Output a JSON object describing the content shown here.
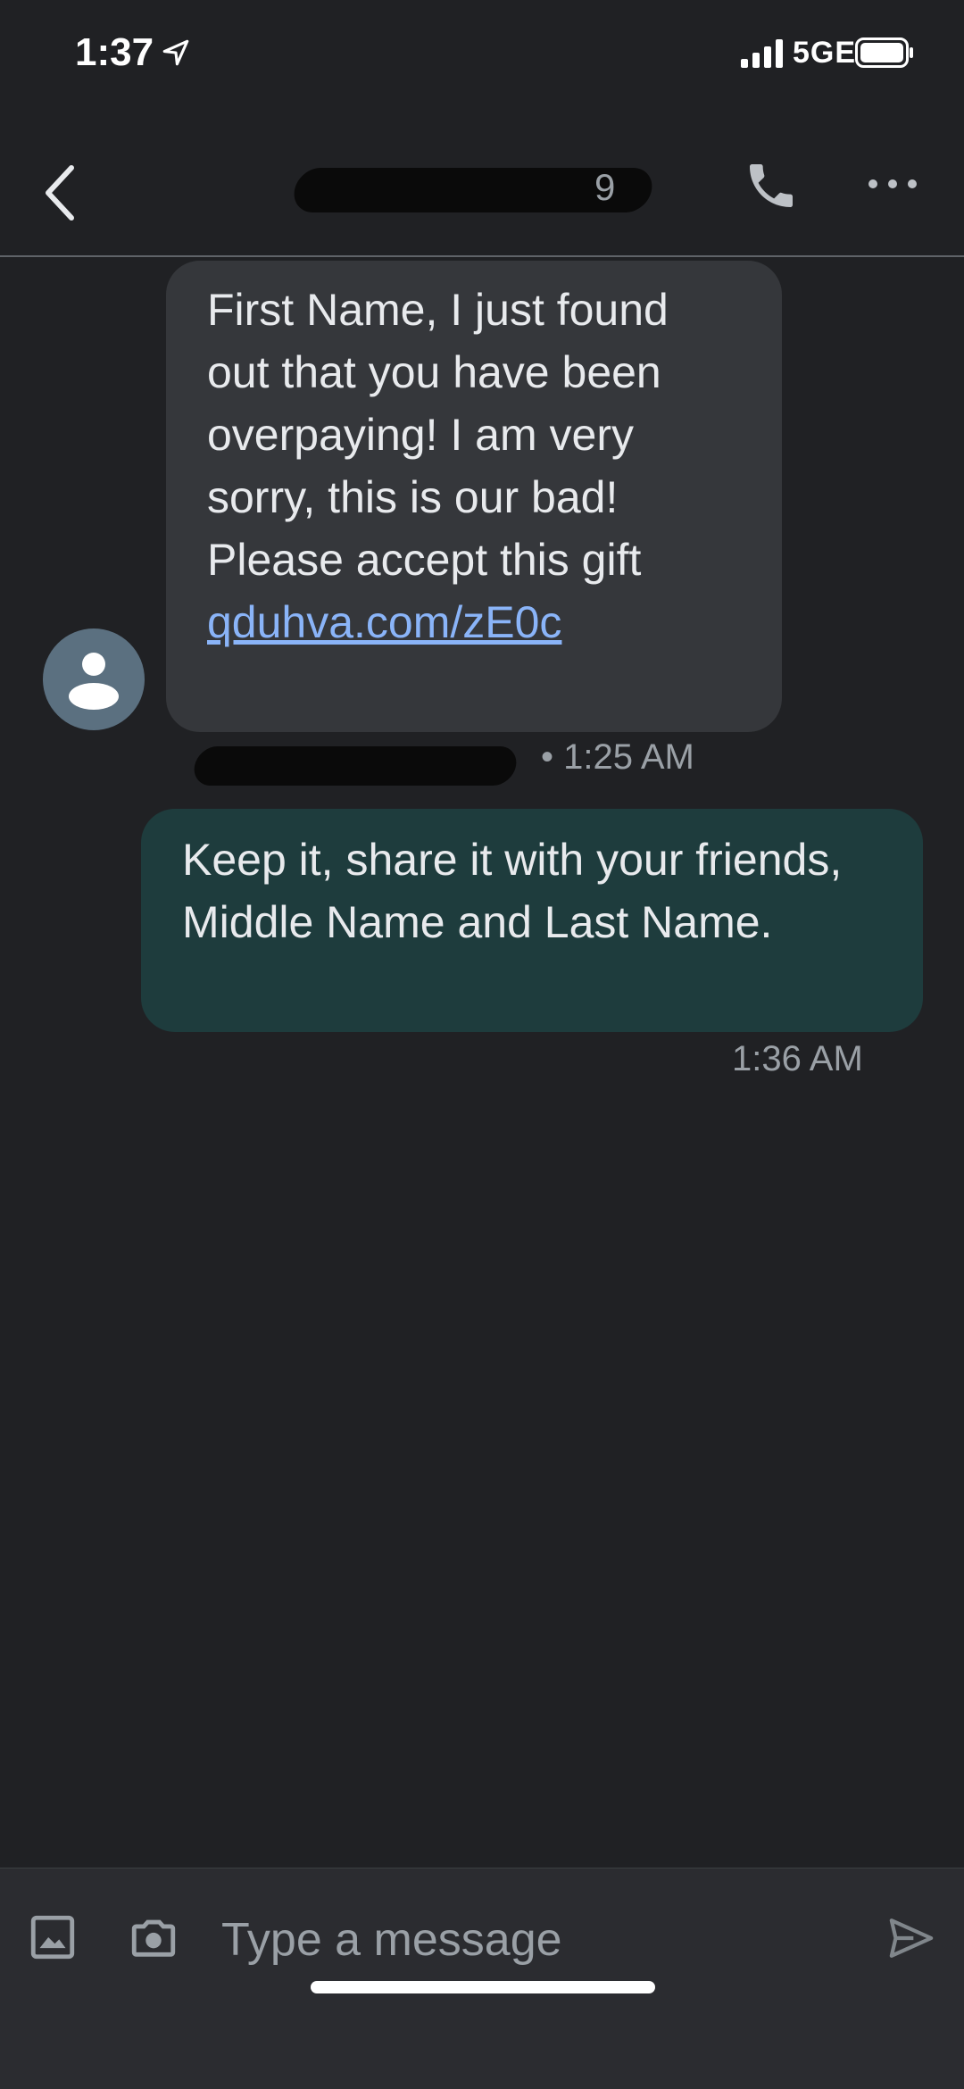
{
  "status_bar": {
    "time": "1:37",
    "network": "5GE",
    "icons": [
      "location-arrow-icon",
      "signal-bars-icon",
      "battery-icon"
    ]
  },
  "header": {
    "contact_name_visible": "9",
    "icons": [
      "back-arrow-icon",
      "phone-icon",
      "more-dots-icon"
    ]
  },
  "messages": [
    {
      "direction": "incoming",
      "text": "First Name, I just found\nout that you have been\noverpaying! I am very\nsorry, this is our bad!\nPlease accept this gift",
      "link": "qduhva.com/zE0c",
      "time": "• 1:25 AM"
    },
    {
      "direction": "outgoing",
      "text": "Keep it, share it with your friends, Middle Name and Last Name.",
      "time": "1:36 AM"
    }
  ],
  "compose": {
    "placeholder": "Type a message",
    "icons": [
      "image-icon",
      "camera-icon",
      "send-icon"
    ]
  },
  "colors": {
    "background": "#202124",
    "incoming_bubble": "#35373b",
    "outgoing_bubble": "#1e3c3d",
    "link": "#8ab4f8",
    "avatar": "#5b7080"
  }
}
